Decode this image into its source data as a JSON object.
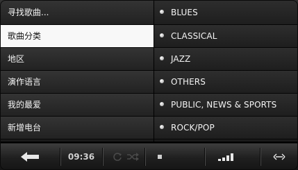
{
  "left_menu": {
    "items": [
      {
        "label": "寻找歌曲..."
      },
      {
        "label": "歌曲分类"
      },
      {
        "label": "地区"
      },
      {
        "label": "演作语言"
      },
      {
        "label": "我的最爱"
      },
      {
        "label": "新增电台"
      }
    ],
    "active_index": 1
  },
  "genre_list": {
    "items": [
      {
        "label": "BLUES"
      },
      {
        "label": "CLASSICAL"
      },
      {
        "label": "JAZZ"
      },
      {
        "label": "OTHERS"
      },
      {
        "label": "PUBLIC, NEWS & SPORTS"
      },
      {
        "label": "ROCK/POP"
      }
    ]
  },
  "bottom_bar": {
    "time": "09:36",
    "icons": [
      "back-arrow-icon",
      "repeat-icon",
      "shuffle-icon",
      "stop-icon",
      "signal-strength-icon",
      "scroll-arrows-icon"
    ]
  },
  "colors": {
    "active_bg": "#f8f8f8",
    "text": "#f4f4f4",
    "background": "#222222"
  }
}
